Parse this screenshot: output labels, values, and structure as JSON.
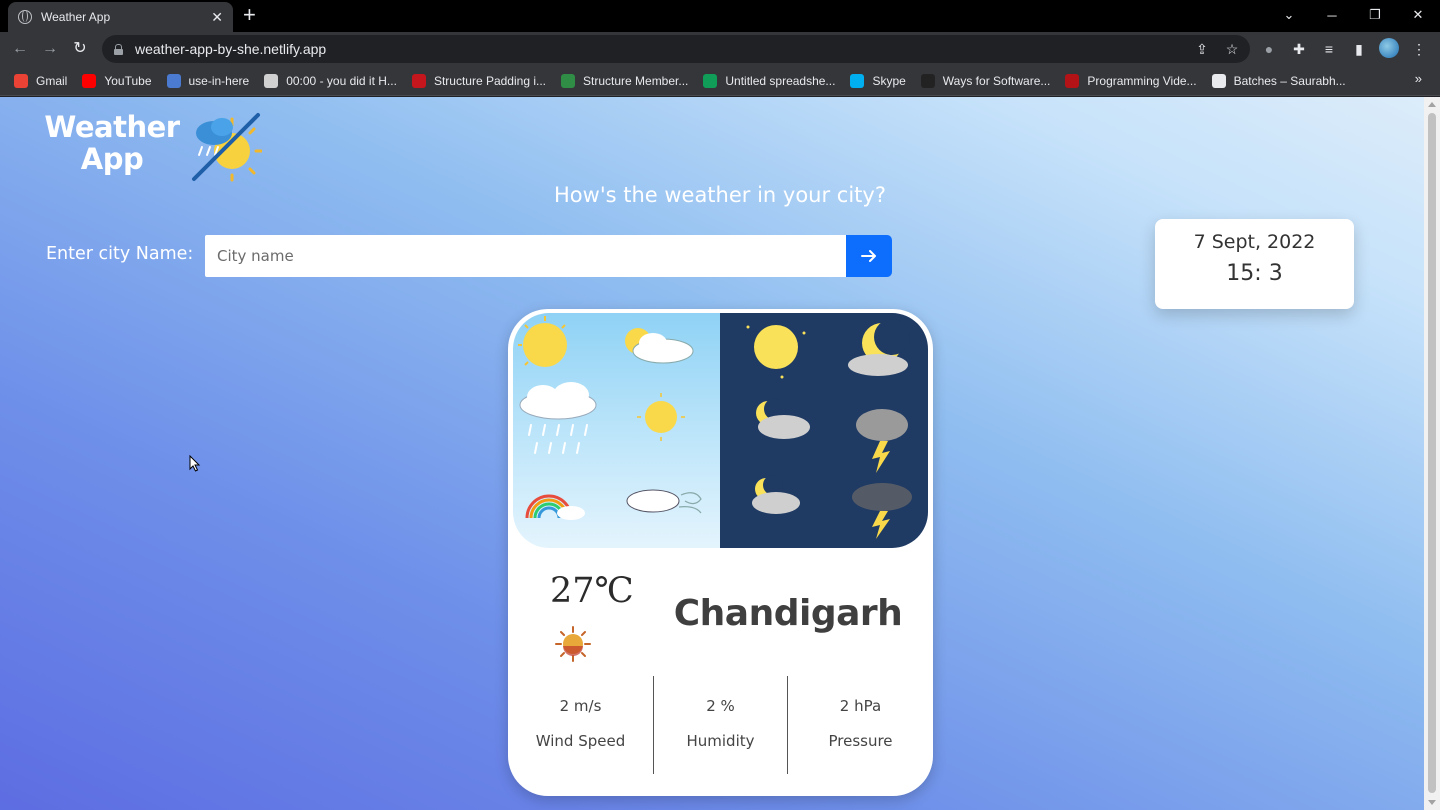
{
  "browser": {
    "tab_title": "Weather App",
    "tab_close": "✕",
    "new_tab": "+",
    "url": "weather-app-by-she.netlify.app",
    "bookmarks": [
      {
        "label": "Gmail",
        "color": "#ea4335"
      },
      {
        "label": "YouTube",
        "color": "#ff0000"
      },
      {
        "label": "use-in-here",
        "color": "#4a7bd0"
      },
      {
        "label": "00:00 - you did it H...",
        "color": "#d0d0d0"
      },
      {
        "label": "Structure Padding i...",
        "color": "#c4161c"
      },
      {
        "label": "Structure Member...",
        "color": "#2f8d46"
      },
      {
        "label": "Untitled spreadshe...",
        "color": "#0f9d58"
      },
      {
        "label": "Skype",
        "color": "#00aff0"
      },
      {
        "label": "Ways for Software...",
        "color": "#222222"
      },
      {
        "label": "Programming Vide...",
        "color": "#b31217"
      },
      {
        "label": "Batches – Saurabh...",
        "color": "#e8eaed"
      }
    ],
    "bookmarks_more": "»"
  },
  "app": {
    "logo_line1": "Weather",
    "logo_line2": "App",
    "headline": "How's the weather in your city?",
    "city_label": "Enter city Name:",
    "city_placeholder": "City name",
    "city_value": "",
    "date": "7 Sept, 2022",
    "time": "15: 3",
    "temperature": "27℃",
    "city": "Chandigarh",
    "stats": {
      "wind_value": "2 m/s",
      "wind_label": "Wind Speed",
      "humidity_value": "2 %",
      "humidity_label": "Humidity",
      "pressure_value": "2 hPa",
      "pressure_label": "Pressure"
    }
  },
  "colors": {
    "accent_button": "#0d6efd",
    "page_gradient_start": "#5d6de2",
    "page_gradient_end": "#dcecfa"
  }
}
